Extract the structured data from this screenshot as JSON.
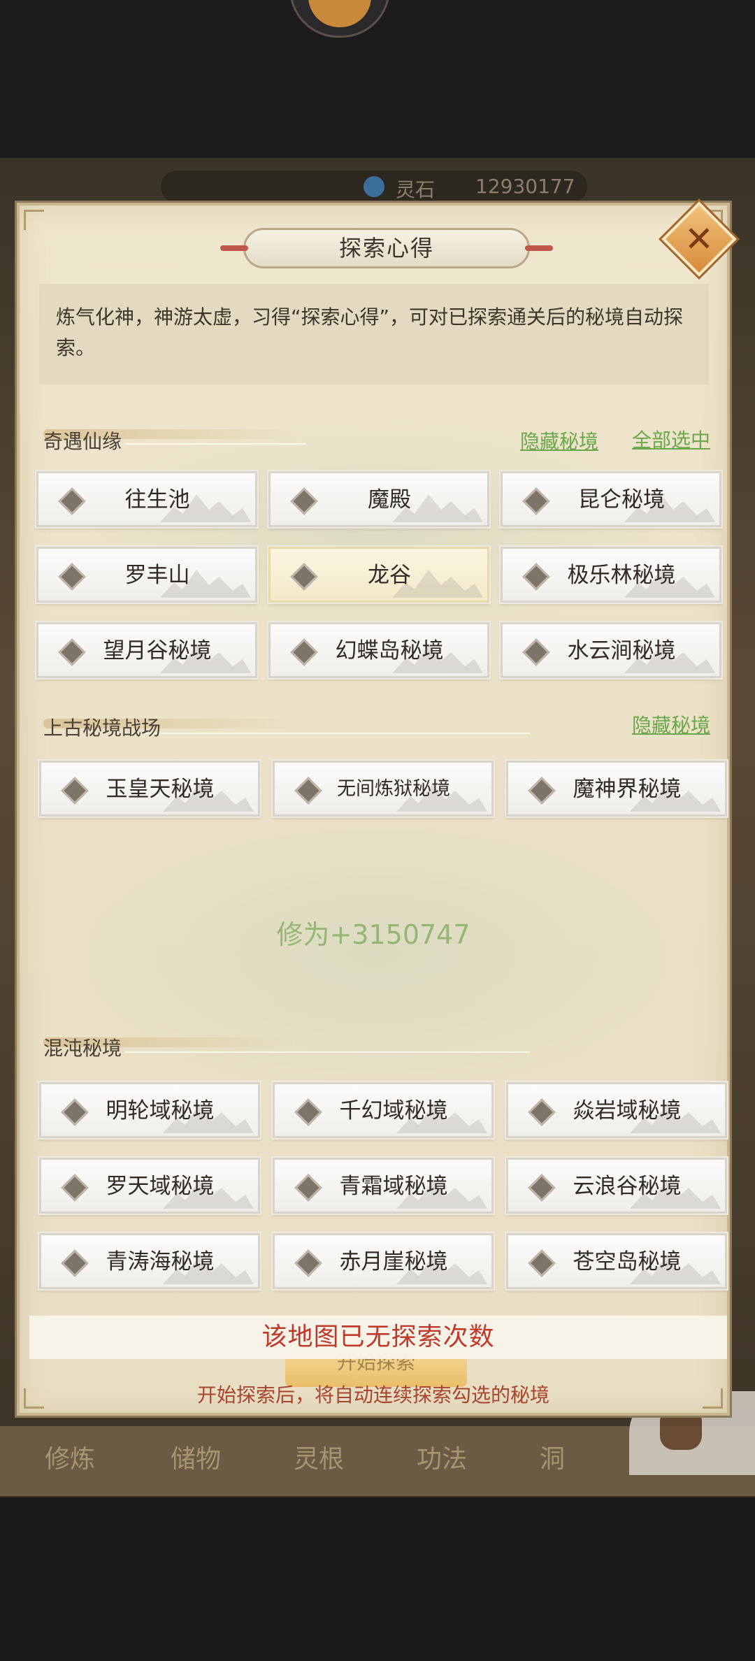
{
  "background": {
    "resource_label": "灵石",
    "resource_value": "12930177",
    "nav": [
      "修炼",
      "储物",
      "灵根",
      "功法",
      "洞"
    ]
  },
  "panel": {
    "title": "探索心得",
    "close_label": "✕",
    "intro": "炼气化神，神游太虚，习得“探索心得”，可对已探索通关后的秘境自动探索。"
  },
  "sections": [
    {
      "title": "奇遇仙缘",
      "links": [
        "隐藏秘境",
        "全部选中"
      ],
      "options": [
        "往生池",
        "魔殿",
        "昆仑秘境",
        "罗丰山",
        "龙谷",
        "极乐林秘境",
        "望月谷秘境",
        "幻蝶岛秘境",
        "水云涧秘境"
      ]
    },
    {
      "title": "上古秘境战场",
      "links": [
        "隐藏秘境"
      ],
      "options": [
        "玉皇天秘境",
        "无间炼狱秘境",
        "魔神界秘境"
      ]
    },
    {
      "title": "混沌秘境",
      "options": [
        "明轮域秘境",
        "千幻域秘境",
        "焱岩域秘境",
        "罗天域秘境",
        "青霜域秘境",
        "云浪谷秘境",
        "青涛海秘境",
        "赤月崖秘境",
        "苍空岛秘境"
      ]
    }
  ],
  "selected_option": "龙谷",
  "floating_text": "修为+3150747",
  "start_button": "开始探索",
  "toast": "该地图已无探索次数",
  "footnote": "开始探索后，将自动连续探索勾选的秘境",
  "colors": {
    "panel_bg": "#ebe1c6",
    "link_green": "#6aa84a",
    "toast_red": "#c0392b",
    "footnote_red": "#a8452e"
  }
}
